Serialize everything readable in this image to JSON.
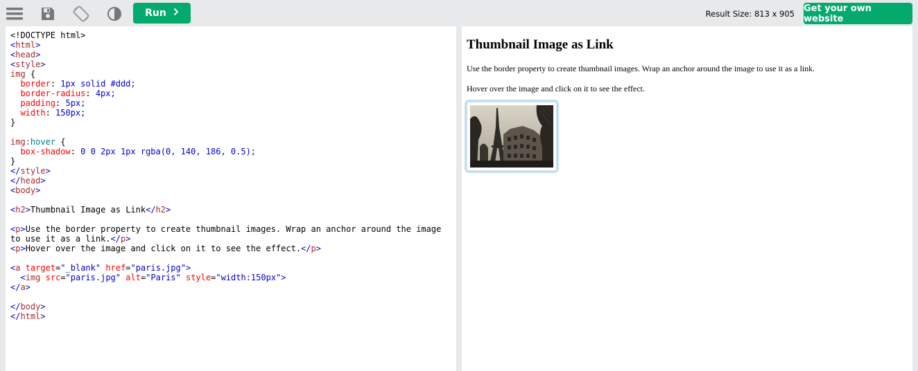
{
  "toolbar": {
    "menu_icon": "hamburger-menu-icon",
    "save_icon": "floppy-disk-icon",
    "rotate_icon": "rotate-screen-icon",
    "theme_icon": "contrast-icon",
    "run_label": "Run",
    "run_icon": "chevron-right-icon",
    "result_size": "Result Size: 813 x 905",
    "own_website_label": "Get your own website"
  },
  "editor": {
    "lines": [
      "<!DOCTYPE html>",
      "<html>",
      "<head>",
      "<style>",
      "img {",
      "  border: 1px solid #ddd;",
      "  border-radius: 4px;",
      "  padding: 5px;",
      "  width: 150px;",
      "}",
      "",
      "img:hover {",
      "  box-shadow: 0 0 2px 1px rgba(0, 140, 186, 0.5);",
      "}",
      "</style>",
      "</head>",
      "<body>",
      "",
      "<h2>Thumbnail Image as Link</h2>",
      "",
      "<p>Use the border property to create thumbnail images. Wrap an anchor around the image",
      "to use it as a link.</p>",
      "<p>Hover over the image and click on it to see the effect.</p>",
      "",
      "<a target=\"_blank\" href=\"paris.jpg\">",
      "  <img src=\"paris.jpg\" alt=\"Paris\" style=\"width:150px\">",
      "</a>",
      "",
      "</body>",
      "</html>"
    ]
  },
  "result": {
    "heading": "Thumbnail Image as Link",
    "paragraph1": "Use the border property to create thumbnail images. Wrap an anchor around the image to use it as a link.",
    "paragraph2": "Hover over the image and click on it to see the effect.",
    "image_alt": "Paris"
  },
  "colors": {
    "accent": "#04aa6d",
    "toolbar_bg": "#e7e9eb"
  }
}
